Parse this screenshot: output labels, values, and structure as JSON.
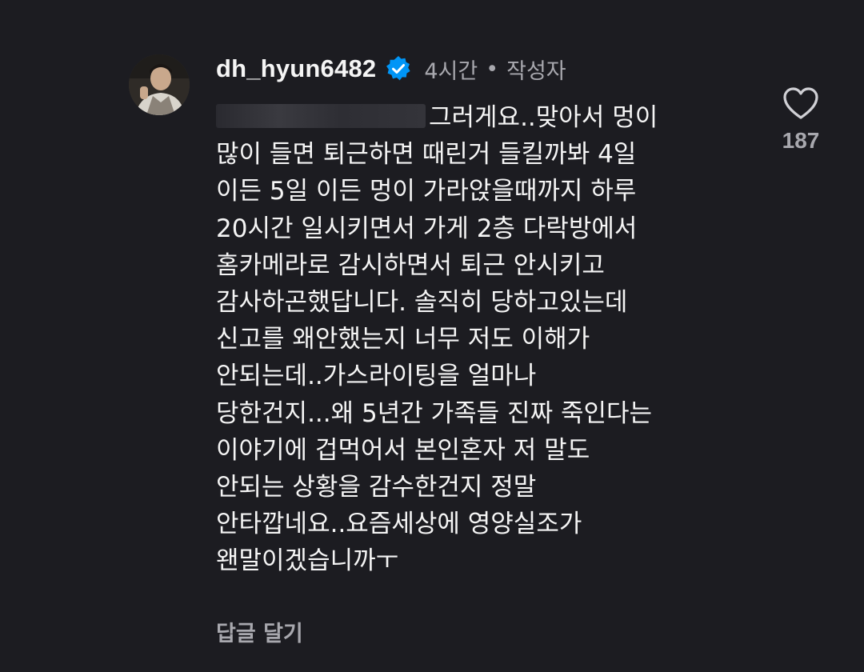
{
  "comment": {
    "username": "dh_hyun6482",
    "verified": true,
    "time": "4시간",
    "separator": "•",
    "author_label": "작성자",
    "lines": [
      "그러게요..맞아서 멍이",
      "많이 들면 퇴근하면 때린거 들킬까봐 4일",
      "이든 5일 이든 멍이 가라앉을때까지 하루",
      "20시간 일시키면서 가게 2층 다락방에서",
      "홈카메라로 감시하면서 퇴근 안시키고",
      "감사하곤했답니다. 솔직히 당하고있는데",
      "신고를 왜안했는지 너무 저도 이해가",
      "안되는데..가스라이팅을 얼마나",
      "당한건지...왜 5년간 가족들 진짜 죽인다는",
      "이야기에 겁먹어서 본인혼자 저 말도",
      "안되는 상황을 감수한건지 정말",
      "안타깝네요..요즘세상에 영양실조가",
      "왠말이겠습니까ㅜ"
    ],
    "reply_label": "답글 달기",
    "like_count": "187"
  },
  "colors": {
    "background": "#1c1c21",
    "primary_text": "#f5f5f5",
    "secondary_text": "#a8a8ae",
    "verified_blue": "#0095f6"
  },
  "icons": {
    "verified": "verified-badge-icon",
    "like": "heart-outline-icon"
  }
}
